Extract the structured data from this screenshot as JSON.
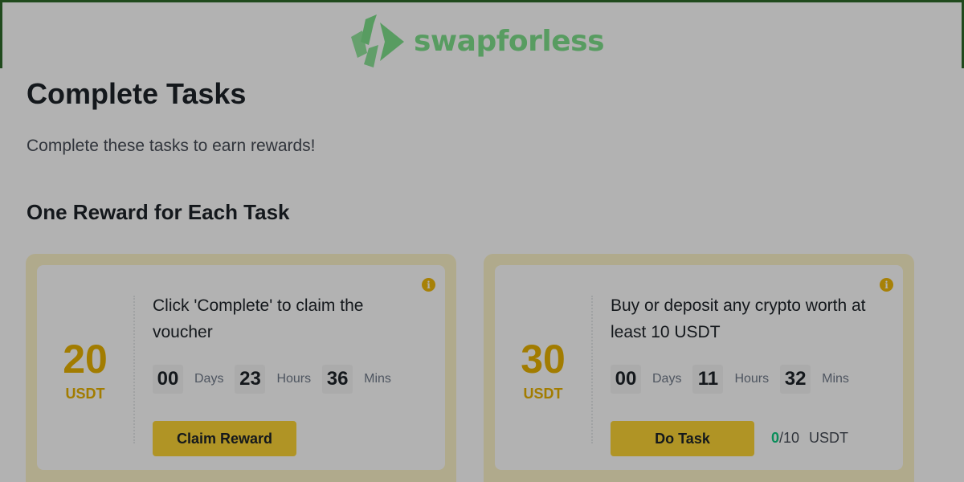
{
  "brand": {
    "logo_icon": "swapforless-logo-icon",
    "logo_text": "swapforless",
    "accent": "#7fe08c"
  },
  "header": {
    "title": "Complete Tasks",
    "subtitle": "Complete these tasks to earn rewards!"
  },
  "section": {
    "title": "One Reward for Each Task"
  },
  "tasks": [
    {
      "amount": "20",
      "unit": "USDT",
      "description": "Click 'Complete' to claim the voucher",
      "countdown": {
        "days": "00",
        "days_label": "Days",
        "hours": "23",
        "hours_label": "Hours",
        "mins": "36",
        "mins_label": "Mins"
      },
      "button_label": "Claim Reward",
      "info_icon": "info-icon"
    },
    {
      "amount": "30",
      "unit": "USDT",
      "description": "Buy or deposit any crypto worth at least 10 USDT",
      "countdown": {
        "days": "00",
        "days_label": "Days",
        "hours": "11",
        "hours_label": "Hours",
        "mins": "32",
        "mins_label": "Mins"
      },
      "button_label": "Do Task",
      "progress": {
        "current": "0",
        "total": "/10",
        "unit": "USDT"
      },
      "info_icon": "info-icon"
    }
  ],
  "colors": {
    "reward_yellow": "#e8b200",
    "button_yellow": "#fcd535",
    "card_border": "#fdf4c9",
    "progress_green": "#0ecb81",
    "dim_overlay": "rgba(0,0,0,0.30)"
  }
}
